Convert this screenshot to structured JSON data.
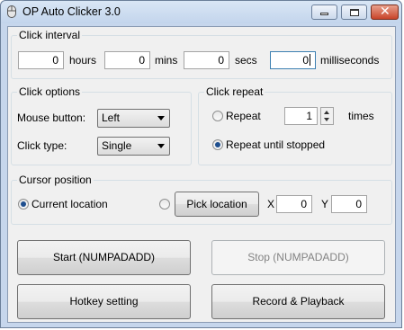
{
  "window": {
    "title": "OP Auto Clicker 3.0"
  },
  "click_interval": {
    "legend": "Click interval",
    "hours": {
      "value": "0",
      "unit": "hours"
    },
    "mins": {
      "value": "0",
      "unit": "mins"
    },
    "secs": {
      "value": "0",
      "unit": "secs"
    },
    "milliseconds": {
      "value": "0",
      "unit": "milliseconds"
    }
  },
  "click_options": {
    "legend": "Click options",
    "mouse_button_label": "Mouse button:",
    "mouse_button_value": "Left",
    "click_type_label": "Click type:",
    "click_type_value": "Single"
  },
  "click_repeat": {
    "legend": "Click repeat",
    "repeat_label": "Repeat",
    "repeat_count": "1",
    "times_label": "times",
    "repeat_until_stopped_label": "Repeat until stopped",
    "selected": "repeat_until_stopped"
  },
  "cursor_position": {
    "legend": "Cursor position",
    "current_location_label": "Current location",
    "pick_location_label": "Pick location",
    "x_label": "X",
    "x_value": "0",
    "y_label": "Y",
    "y_value": "0",
    "selected": "current_location"
  },
  "buttons": {
    "start": "Start (NUMPADADD)",
    "stop": "Stop (NUMPADADD)",
    "hotkey": "Hotkey setting",
    "record": "Record & Playback"
  }
}
